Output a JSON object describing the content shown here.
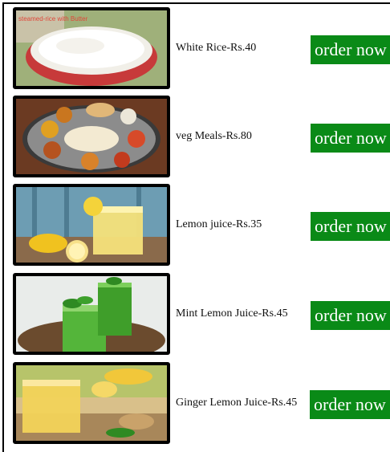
{
  "button_label": "order now",
  "items": [
    {
      "label": "White Rice-Rs.40",
      "image_overlay": "steamed-rice with Butter",
      "image_icon": "white-rice-bowl"
    },
    {
      "label": "veg Meals-Rs.80",
      "image_icon": "veg-thali-plate"
    },
    {
      "label": "Lemon juice-Rs.35",
      "image_icon": "lemon-juice-glass"
    },
    {
      "label": "Mint Lemon Juice-Rs.45",
      "image_icon": "mint-juice-glasses"
    },
    {
      "label": "Ginger Lemon Juice-Rs.45",
      "image_icon": "ginger-lemon-juice-glass"
    }
  ]
}
